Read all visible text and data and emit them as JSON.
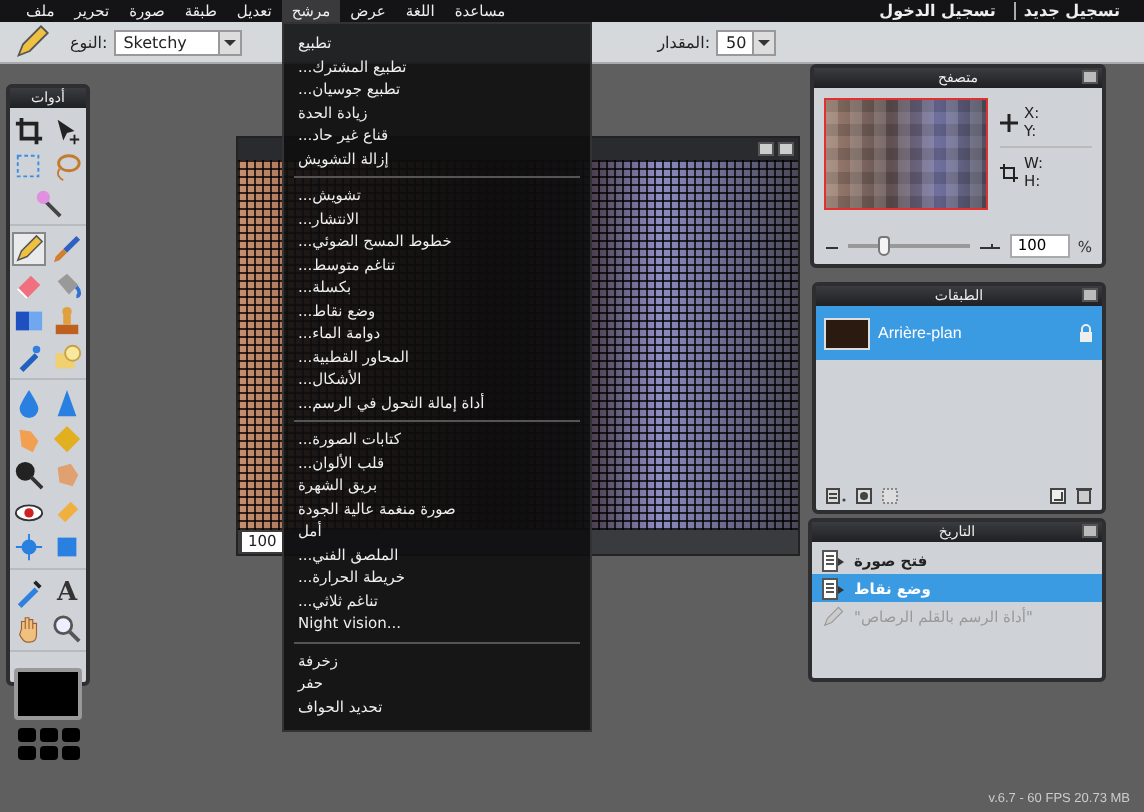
{
  "menubar": {
    "items": [
      {
        "label": "مساعدة",
        "selected": false
      },
      {
        "label": "اللغة",
        "selected": false
      },
      {
        "label": "عرض",
        "selected": false
      },
      {
        "label": "مرشح",
        "selected": true
      },
      {
        "label": "تعديل",
        "selected": false
      },
      {
        "label": "طبقة",
        "selected": false
      },
      {
        "label": "صورة",
        "selected": false
      },
      {
        "label": "تحرير",
        "selected": false
      },
      {
        "label": "ملف",
        "selected": false
      }
    ],
    "account": [
      {
        "label": "تسجيل جديد"
      },
      {
        "label": "تسجيل الدخول"
      }
    ]
  },
  "options_bar": {
    "type_label": "النوع:",
    "type_value": "Sketchy",
    "amount_label": "المقدار:",
    "amount_value": "50"
  },
  "tools": {
    "title": "أدوات",
    "groups": [
      [
        {
          "kind": "crop",
          "selected": false
        },
        {
          "kind": "move",
          "selected": false
        },
        {
          "kind": "marquee",
          "selected": false
        },
        {
          "kind": "lasso",
          "selected": false
        },
        {
          "kind": "wand",
          "selected": false
        }
      ],
      [
        {
          "kind": "pencil",
          "selected": true
        },
        {
          "kind": "brush",
          "selected": false
        },
        {
          "kind": "eraser",
          "selected": false
        },
        {
          "kind": "bucket",
          "selected": false
        },
        {
          "kind": "gradient",
          "selected": false
        },
        {
          "kind": "stamp",
          "selected": false
        },
        {
          "kind": "replace",
          "selected": false
        },
        {
          "kind": "drawing",
          "selected": false
        }
      ],
      [
        {
          "kind": "blur",
          "selected": false
        },
        {
          "kind": "sharpen",
          "selected": false
        },
        {
          "kind": "smudge",
          "selected": false
        },
        {
          "kind": "sponge",
          "selected": false
        },
        {
          "kind": "burn",
          "selected": false
        },
        {
          "kind": "dodge",
          "selected": false
        },
        {
          "kind": "redeye",
          "selected": false
        },
        {
          "kind": "heal",
          "selected": false
        },
        {
          "kind": "bloat",
          "selected": false
        },
        {
          "kind": "pinch",
          "selected": false
        }
      ],
      [
        {
          "kind": "eyedropper",
          "selected": false
        },
        {
          "kind": "type",
          "selected": false,
          "glyph": "A"
        },
        {
          "kind": "hand",
          "selected": false
        },
        {
          "kind": "zoom",
          "selected": false
        }
      ]
    ]
  },
  "image_window": {
    "zoom": "100"
  },
  "filter_menu": {
    "sections": [
      [
        "تطبيع",
        "تطبيع المشترك...",
        "تطبيع جوسيان...",
        "زيادة الحدة",
        "قناع غير حاد...",
        "إزالة التشويش"
      ],
      [
        "تشويش...",
        "الانتشار...",
        "خطوط المسح الضوئي...",
        "تناغم متوسط...",
        "بكسلة...",
        "وضع نقاط...",
        "دوامة الماء...",
        "المحاور القطبية...",
        "الأشكال...",
        "أداة إمالة التحول في الرسم..."
      ],
      [
        "كتابات الصورة...",
        "قلب الألوان...",
        "بريق الشهرة",
        "صورة منغمة عالية الجودة",
        "أمل",
        "الملصق الفني...",
        "خريطة الحرارة...",
        "تناغم ثلاثي...",
        "Night vision..."
      ],
      [
        "زخرفة",
        "حفر",
        "تحديد الحواف"
      ]
    ]
  },
  "navigator": {
    "title": "متصفح",
    "x_label": "X:",
    "y_label": "Y:",
    "w_label": "W:",
    "h_label": "H:",
    "zoom": {
      "level": 0.3
    },
    "zoom_value": "100",
    "percent": "%"
  },
  "layers": {
    "title": "الطبقات",
    "items": [
      {
        "name": "Arrière-plan",
        "selected": true,
        "locked": true
      }
    ]
  },
  "history": {
    "title": "التاريخ",
    "items": [
      {
        "label": "فتح صورة",
        "selected": false,
        "disabled": false
      },
      {
        "label": "وضع نقاط",
        "selected": true,
        "disabled": false
      },
      {
        "label": "\"أداة الرسم بالقلم الرصاص\"",
        "selected": false,
        "disabled": true
      }
    ]
  },
  "status": "v.6.7 - 60 FPS 20.73 MB"
}
